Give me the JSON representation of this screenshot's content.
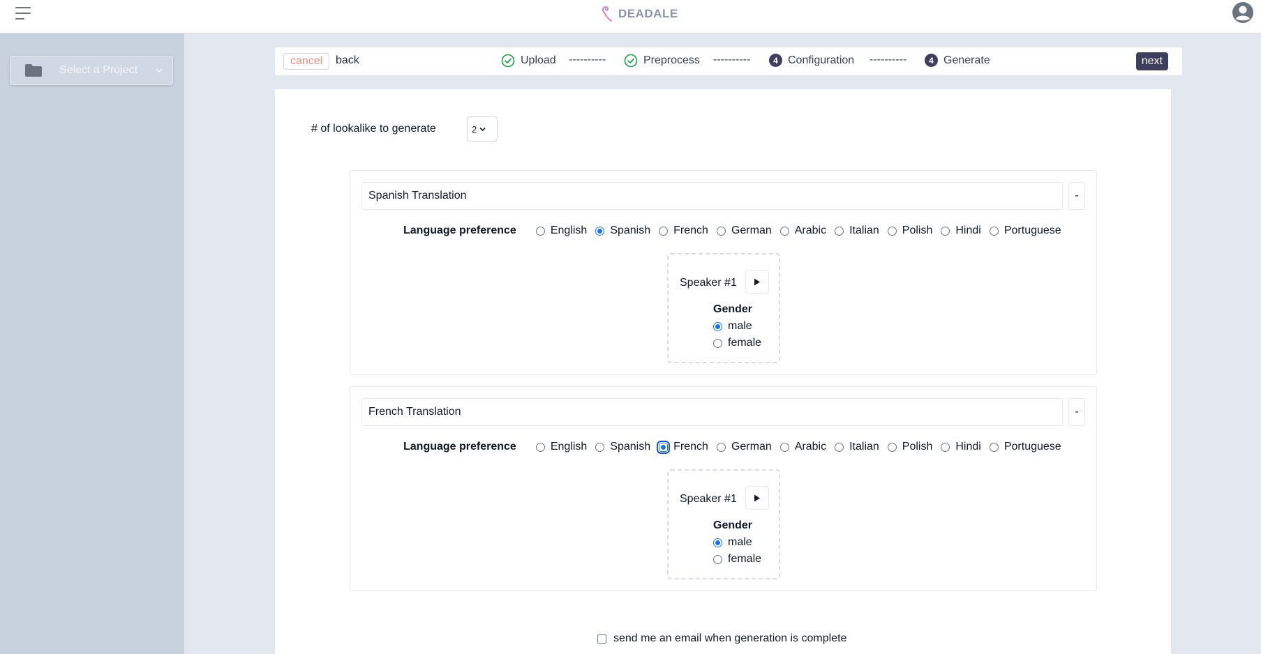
{
  "app": {
    "brand": "DEADALE"
  },
  "sidebar": {
    "project_select": "Select a Project"
  },
  "stepper": {
    "cancel_label": "cancel",
    "back_label": "back",
    "next_label": "next",
    "separator": "----------",
    "steps": [
      {
        "label": "Upload",
        "status": "done"
      },
      {
        "label": "Preprocess",
        "status": "done"
      },
      {
        "label": "Configuration",
        "status": "current",
        "badge": "4"
      },
      {
        "label": "Generate",
        "status": "pending",
        "badge": "4"
      }
    ]
  },
  "config": {
    "lookalike_label": "# of lookalike to generate",
    "lookalike_value": "2"
  },
  "translations": [
    {
      "title": "Spanish Translation",
      "remove_label": "-",
      "language_label": "Language preference",
      "languages": [
        "English",
        "Spanish",
        "French",
        "German",
        "Arabic",
        "Italian",
        "Polish",
        "Hindi",
        "Portuguese"
      ],
      "selected_language": "Spanish",
      "speaker": {
        "title": "Speaker #1",
        "gender_label": "Gender",
        "options": [
          "male",
          "female"
        ],
        "selected": "male"
      }
    },
    {
      "title": "French Translation",
      "remove_label": "-",
      "language_label": "Language preference",
      "languages": [
        "English",
        "Spanish",
        "French",
        "German",
        "Arabic",
        "Italian",
        "Polish",
        "Hindi",
        "Portuguese"
      ],
      "selected_language": "French",
      "speaker": {
        "title": "Speaker #1",
        "gender_label": "Gender",
        "options": [
          "male",
          "female"
        ],
        "selected": "male"
      }
    }
  ],
  "email_notify": {
    "label": "send me an email when generation is complete",
    "checked": false
  },
  "colors": {
    "accent": "#3d3f5c",
    "success": "#16a34a",
    "radio": "#1a73e8",
    "cancel": "#f28b82"
  }
}
